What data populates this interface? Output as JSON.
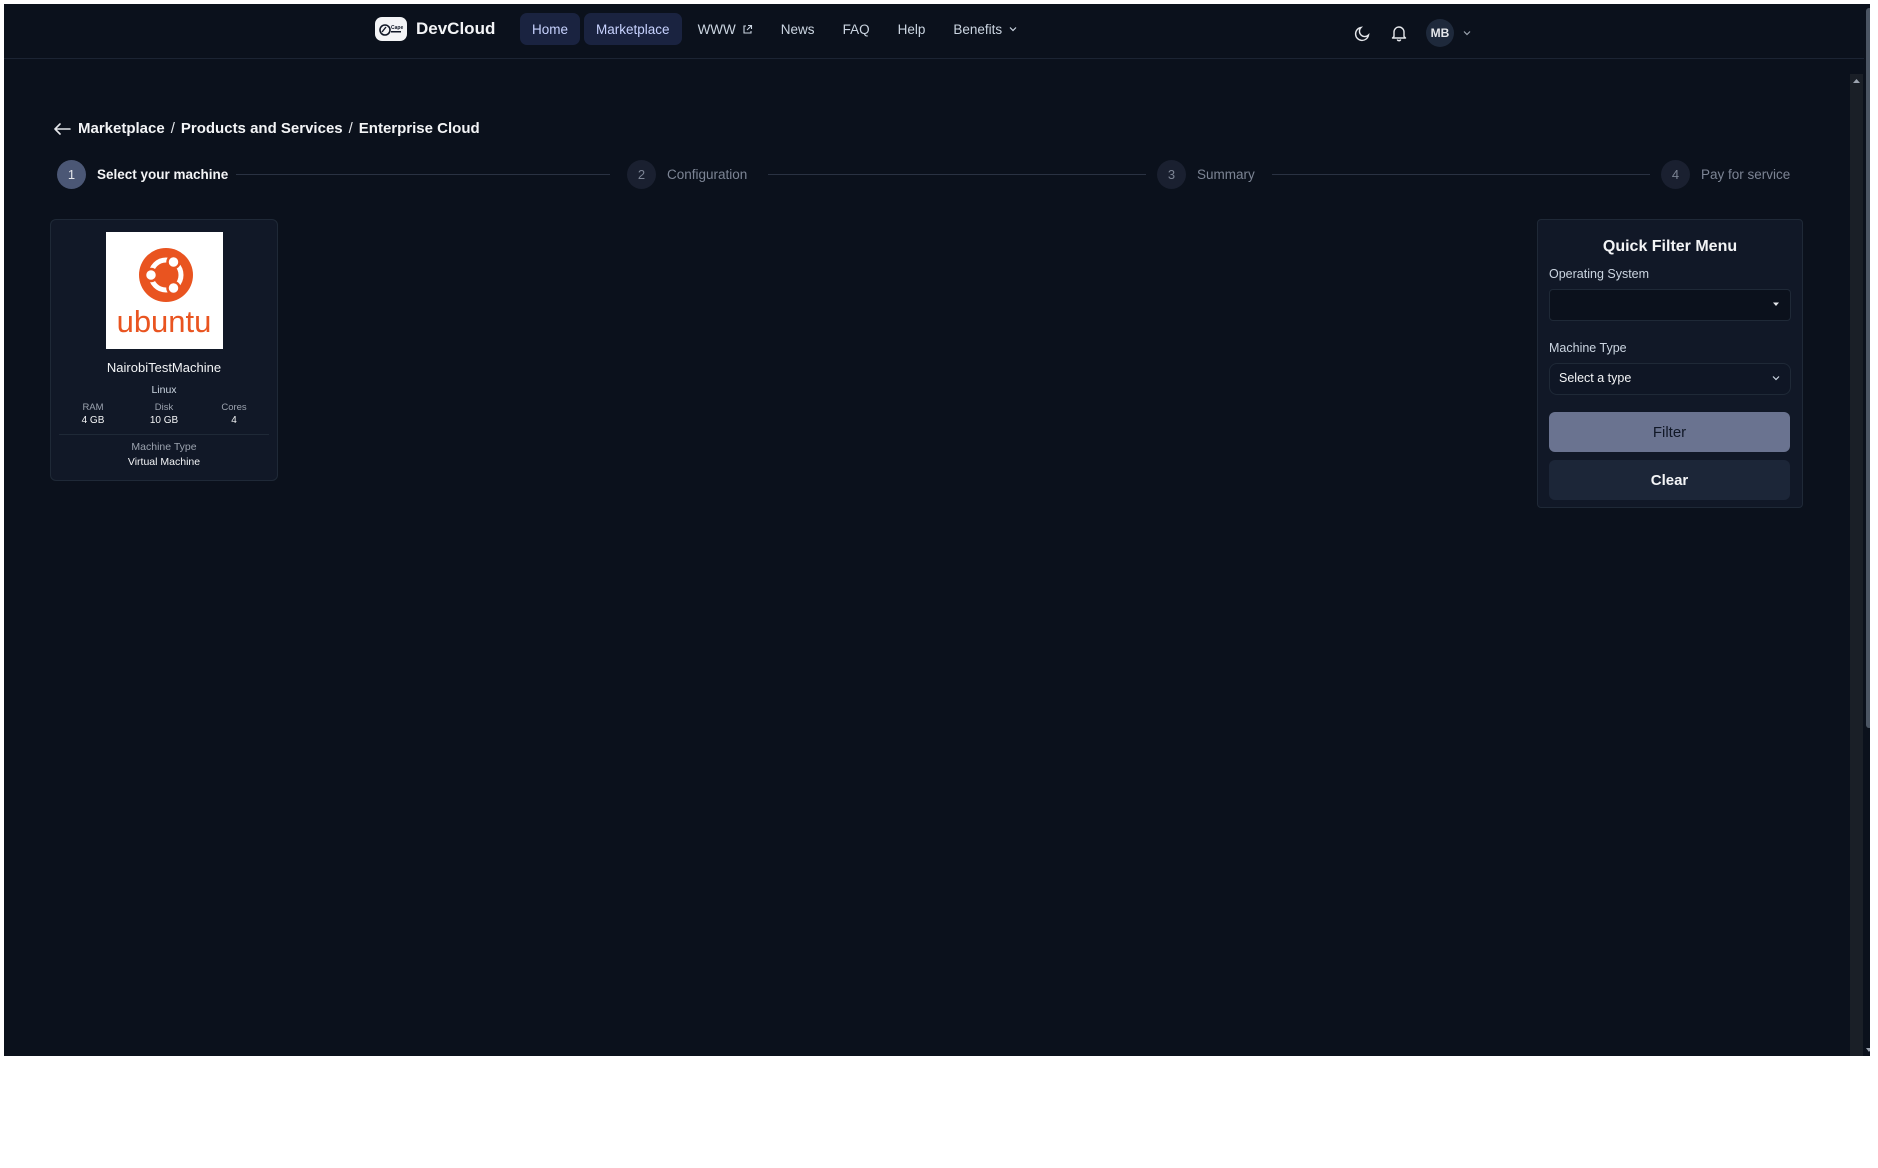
{
  "header": {
    "logo_text": "DevCloud",
    "logo_badge_text": "Cape",
    "nav": [
      {
        "label": "Home",
        "active": true
      },
      {
        "label": "Marketplace",
        "active": true
      },
      {
        "label": "WWW",
        "external": true
      },
      {
        "label": "News"
      },
      {
        "label": "FAQ"
      },
      {
        "label": "Help"
      },
      {
        "label": "Benefits",
        "dropdown": true
      }
    ],
    "user_initials": "MB"
  },
  "breadcrumb": {
    "items": [
      "Marketplace",
      "Products and Services",
      "Enterprise Cloud"
    ],
    "separator": "/"
  },
  "stepper": [
    {
      "number": "1",
      "label": "Select your machine",
      "active": true
    },
    {
      "number": "2",
      "label": "Configuration"
    },
    {
      "number": "3",
      "label": "Summary"
    },
    {
      "number": "4",
      "label": "Pay for service"
    }
  ],
  "machines": [
    {
      "logo_text": "ubuntu",
      "name": "NairobiTestMachine",
      "os": "Linux",
      "specs": [
        {
          "label": "RAM",
          "value": "4 GB"
        },
        {
          "label": "Disk",
          "value": "10 GB"
        },
        {
          "label": "Cores",
          "value": "4"
        }
      ],
      "machine_type_label": "Machine Type",
      "machine_type_value": "Virtual Machine"
    }
  ],
  "filter": {
    "title": "Quick Filter Menu",
    "os_label": "Operating System",
    "os_value": "",
    "type_label": "Machine Type",
    "type_value": "Select a type",
    "filter_button": "Filter",
    "clear_button": "Clear"
  },
  "colors": {
    "background": "#0b111c",
    "card": "#111827",
    "accent": "#1a2340",
    "ubuntu_orange": "#e95420"
  }
}
